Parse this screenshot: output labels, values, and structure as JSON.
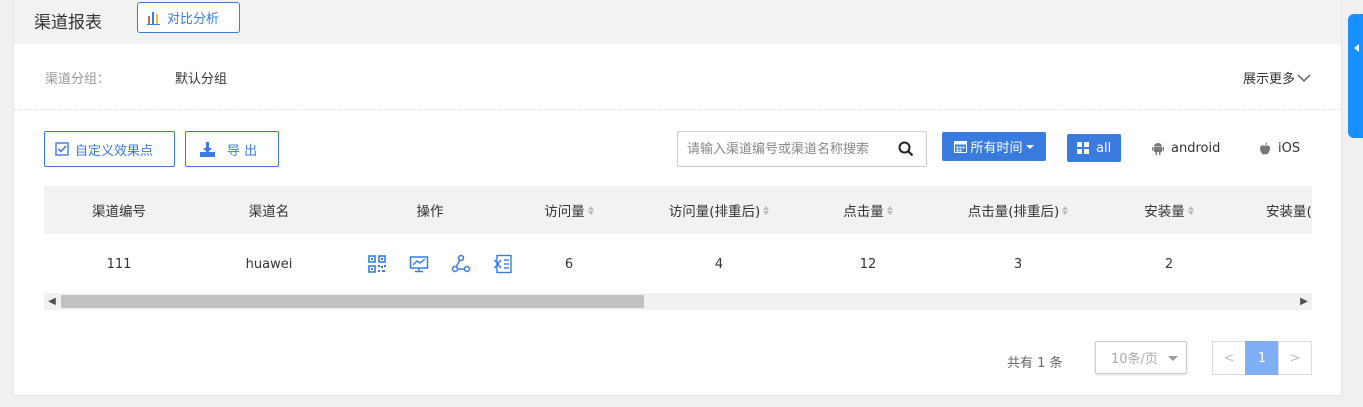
{
  "page": {
    "title": "渠道报表",
    "compare_label": "对比分析"
  },
  "group": {
    "label": "渠道分组：",
    "value": "默认分组",
    "more_label": "展示更多"
  },
  "toolbar": {
    "custom_label": "自定义效果点",
    "export_label": "导 出",
    "search_placeholder": "请输入渠道编号或渠道名称搜索",
    "time_label": "所有时间",
    "platforms": [
      "all",
      "android",
      "iOS"
    ]
  },
  "table": {
    "headers": [
      "渠道编号",
      "渠道名",
      "操作",
      "访问量",
      "访问量(排重后)",
      "点击量",
      "点击量(排重后)",
      "安装量",
      "安装量("
    ],
    "rows": [
      {
        "id": "111",
        "name": "huawei",
        "visits": "6",
        "visits_dedup": "4",
        "clicks": "12",
        "clicks_dedup": "3",
        "installs": "2"
      }
    ],
    "op_icons": [
      "qrcode-icon",
      "monitor-chart-icon",
      "share-icon",
      "excel-export-icon"
    ]
  },
  "pagination": {
    "total": "共有 1 条",
    "page_size": "10条/页",
    "prev": "<",
    "current": "1",
    "next": ">"
  },
  "colors": {
    "accent": "#3a7be0",
    "side_tab": "#1890ff",
    "current_page": "#7fb0f5"
  }
}
